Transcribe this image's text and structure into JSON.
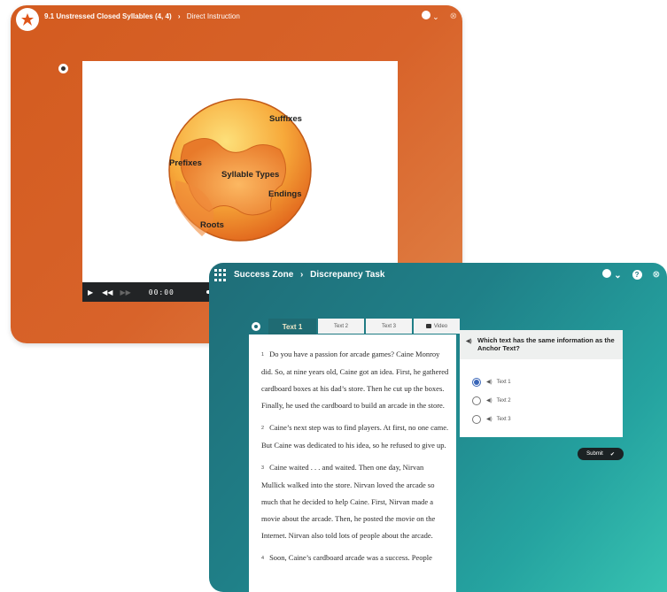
{
  "lesson_window": {
    "breadcrumb_title": "9.1 Unstressed Closed Syllables (4, 4)",
    "breadcrumb_section": "Direct Instruction",
    "puzzle_labels": {
      "suffixes": "Suffixes",
      "prefixes": "Prefixes",
      "syllable_types": "Syllable Types",
      "endings": "Endings",
      "roots": "Roots"
    },
    "video": {
      "time": "00:00"
    },
    "colors": {
      "background": "#d35b1f",
      "slide": "#ffffff"
    }
  },
  "task_window": {
    "breadcrumb_title": "Success Zone",
    "breadcrumb_section": "Discrepancy Task",
    "tabs": [
      {
        "label": "Text 1",
        "active": true
      },
      {
        "label": "Text 2",
        "active": false
      },
      {
        "label": "Text 3",
        "active": false
      },
      {
        "label": "Video",
        "active": false,
        "icon": "video-icon"
      }
    ],
    "paragraphs": [
      {
        "num": "1",
        "text": "Do you have a passion for arcade games? Caine Monroy did. So, at nine years old, Caine got an idea. First, he gathered cardboard boxes at his dad’s store. Then he cut up the boxes. Finally, he used the cardboard to build an arcade in the store."
      },
      {
        "num": "2",
        "text": "Caine’s next step was to find players. At first, no one came. But Caine was dedicated to his idea, so he refused to give up."
      },
      {
        "num": "3",
        "text": "Caine waited . . . and waited. Then one day, Nirvan Mullick walked into the store. Nirvan loved the arcade so much that he decided to help Caine. First, Nirvan made a movie about the arcade. Then, he posted the movie on the Internet. Nirvan also told lots of people about the arcade."
      },
      {
        "num": "4",
        "text": "Soon, Caine’s cardboard arcade was a success. People"
      }
    ],
    "question": "Which text has the same information as the Anchor Text?",
    "options": [
      {
        "label": "Text 1",
        "selected": true
      },
      {
        "label": "Text 2",
        "selected": false
      },
      {
        "label": "Text 3",
        "selected": false
      }
    ],
    "submit_label": "Submit",
    "colors": {
      "header": "#1f6b73",
      "accent": "#37c2b1",
      "selected": "#3a66b8"
    }
  }
}
